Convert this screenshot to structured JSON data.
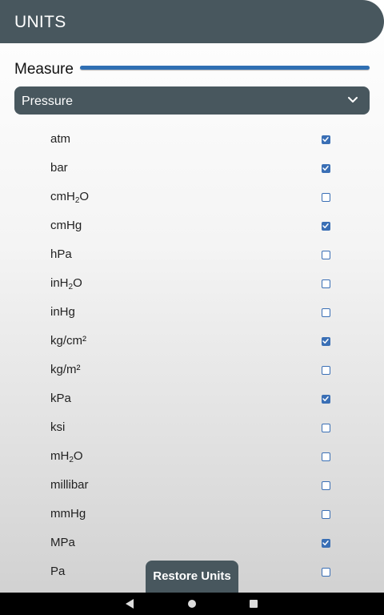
{
  "app_bar": {
    "title": "UNITS"
  },
  "measure": {
    "label": "Measure",
    "selected": "Pressure"
  },
  "units": [
    {
      "base": "atm",
      "sub": "",
      "tail": "",
      "checked": true
    },
    {
      "base": "bar",
      "sub": "",
      "tail": "",
      "checked": true
    },
    {
      "base": "cmH",
      "sub": "2",
      "tail": "O",
      "checked": false
    },
    {
      "base": "cmHg",
      "sub": "",
      "tail": "",
      "checked": true
    },
    {
      "base": "hPa",
      "sub": "",
      "tail": "",
      "checked": false
    },
    {
      "base": "inH",
      "sub": "2",
      "tail": "O",
      "checked": false
    },
    {
      "base": "inHg",
      "sub": "",
      "tail": "",
      "checked": false
    },
    {
      "base": "kg/cm²",
      "sub": "",
      "tail": "",
      "checked": true
    },
    {
      "base": "kg/m²",
      "sub": "",
      "tail": "",
      "checked": false
    },
    {
      "base": "kPa",
      "sub": "",
      "tail": "",
      "checked": true
    },
    {
      "base": "ksi",
      "sub": "",
      "tail": "",
      "checked": false
    },
    {
      "base": "mH",
      "sub": "2",
      "tail": "O",
      "checked": false
    },
    {
      "base": "millibar",
      "sub": "",
      "tail": "",
      "checked": false
    },
    {
      "base": "mmHg",
      "sub": "",
      "tail": "",
      "checked": false
    },
    {
      "base": "MPa",
      "sub": "",
      "tail": "",
      "checked": true
    },
    {
      "base": "Pa",
      "sub": "",
      "tail": "",
      "checked": false
    }
  ],
  "restore_button": {
    "label": "Restore Units"
  },
  "colors": {
    "header": "#48575e",
    "accent": "#3a6fb5"
  },
  "icons": {
    "dropdown": "chevron-down-icon",
    "nav": [
      "back-icon",
      "home-icon",
      "recents-icon"
    ]
  }
}
